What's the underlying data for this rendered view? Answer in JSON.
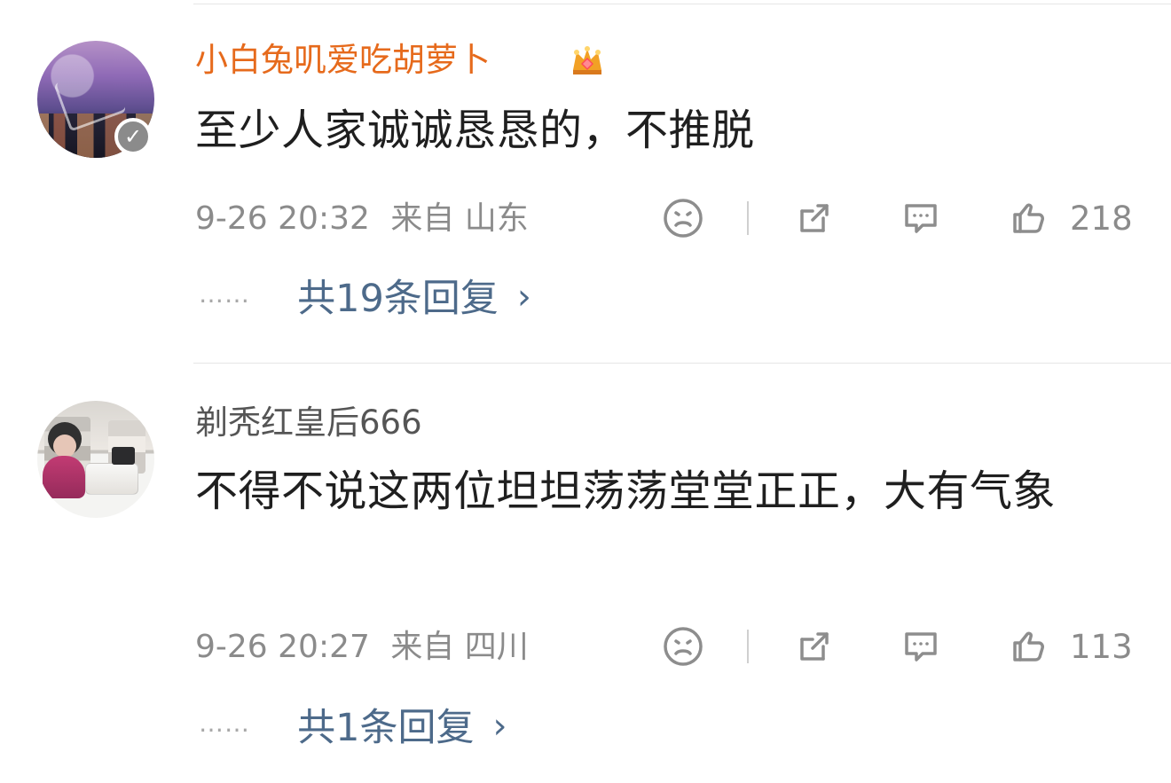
{
  "comments": [
    {
      "username": "小白兔叽爱吃胡萝卜",
      "content": "至少人家诚诚恳恳的，不推脱",
      "time": "9-26 20:32",
      "source": "来自 山东",
      "likes": "218",
      "replies": "共19条回复",
      "verified_badge": "✓"
    },
    {
      "username": "剃秃红皇后666",
      "content": "不得不说这两位坦坦荡荡堂堂正正，大有气象",
      "time": "9-26 20:27",
      "source": "来自 四川",
      "likes": "113",
      "replies": "共1条回复"
    }
  ],
  "ui": {
    "dots": "……",
    "reply_chevron": "›",
    "colors": {
      "username_highlight": "#e66a1c",
      "link": "#4d6a8a",
      "meta": "#8b8b8b"
    },
    "icons": {
      "dislike": "sad-face-icon",
      "share": "share-icon",
      "comment": "comment-icon",
      "like": "thumbs-up-icon",
      "crown": "crown-icon"
    }
  }
}
